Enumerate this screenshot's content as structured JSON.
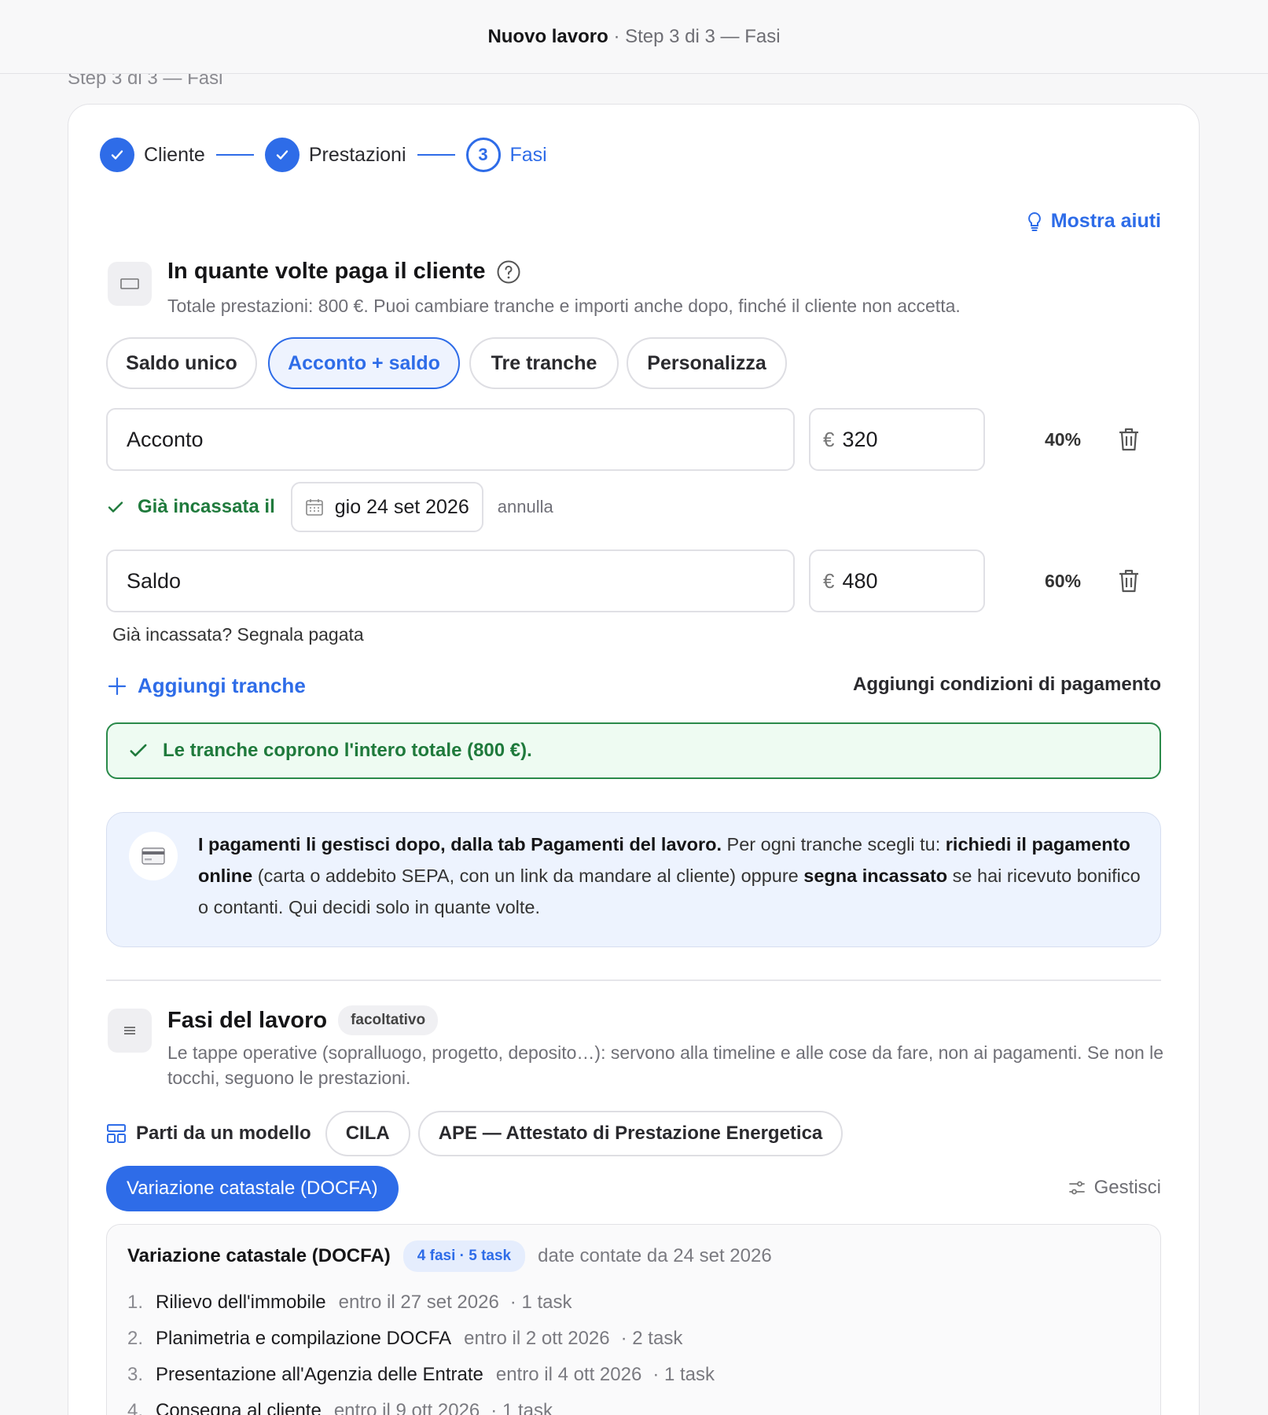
{
  "header": {
    "title": "Nuovo lavoro",
    "separator": " · ",
    "subtitle": "Step 3 di 3 — Fasi"
  },
  "background_step_label": "Step 3 di 3 — Fasi",
  "stepper": [
    {
      "label": "Cliente",
      "state": "done"
    },
    {
      "label": "Prestazioni",
      "state": "done"
    },
    {
      "label": "Fasi",
      "number": "3",
      "state": "active"
    }
  ],
  "help_link": "Mostra aiuti",
  "payment": {
    "title": "In quante volte paga il cliente",
    "description": "Totale prestazioni: 800 €. Puoi cambiare tranche e importi anche dopo, finché il cliente non accetta.",
    "options": [
      "Saldo unico",
      "Acconto + saldo",
      "Tre tranche",
      "Personalizza"
    ],
    "selected_option": "Acconto + saldo",
    "currency": "€",
    "tranches": [
      {
        "name": "Acconto",
        "amount": "320",
        "percent": "40%"
      },
      {
        "name": "Saldo",
        "amount": "480",
        "percent": "60%"
      }
    ],
    "paid_label": "Già incassata il",
    "paid_date": "gio 24 set 2026",
    "undo_label": "annulla",
    "mark_paid": "Già incassata? Segnala pagata",
    "add_tranche": "Aggiungi tranche",
    "add_conditions": "Aggiungi condizioni di pagamento",
    "coverage_ok": "Le tranche coprono l'intero totale (800 €)."
  },
  "info": {
    "bold1": "I pagamenti li gestisci dopo, dalla tab Pagamenti del lavoro.",
    "text1": " Per ogni tranche scegli tu: ",
    "bold2": "richiedi il pagamento online",
    "text2": " (carta o addebito SEPA, con un link da mandare al cliente) oppure ",
    "bold3": "segna incassato",
    "text3": " se hai ricevuto bonifico o contanti. Qui decidi solo in quante volte."
  },
  "phases": {
    "title": "Fasi del lavoro",
    "badge": "facoltativo",
    "description": "Le tappe operative (sopralluogo, progetto, deposito…): servono alla timeline e alle cose da fare, non ai pagamenti. Se non le tocchi, seguono le prestazioni.",
    "template_label": "Parti da un modello",
    "templates": [
      "CILA",
      "APE — Attestato di Prestazione Energetica"
    ],
    "active_template": "Variazione catastale (DOCFA)",
    "manage": "Gestisci",
    "model": {
      "name": "Variazione catastale (DOCFA)",
      "badge": "4 fasi · 5 task",
      "dates": "date contate da 24 set 2026",
      "items": [
        {
          "num": "1.",
          "name": "Rilievo dell'immobile",
          "due": "entro il 27 set 2026",
          "tasks": "· 1 task"
        },
        {
          "num": "2.",
          "name": "Planimetria e compilazione DOCFA",
          "due": "entro il 2 ott 2026",
          "tasks": "· 2 task"
        },
        {
          "num": "3.",
          "name": "Presentazione all'Agenzia delle Entrate",
          "due": "entro il 4 ott 2026",
          "tasks": "· 1 task"
        },
        {
          "num": "4.",
          "name": "Consegna al cliente",
          "due": "entro il 9 ott 2026",
          "tasks": "· 1 task"
        }
      ]
    }
  },
  "colors": {
    "accent": "#2e6ce8",
    "success": "#1f7a3c",
    "info_bg": "#edf3fe"
  }
}
